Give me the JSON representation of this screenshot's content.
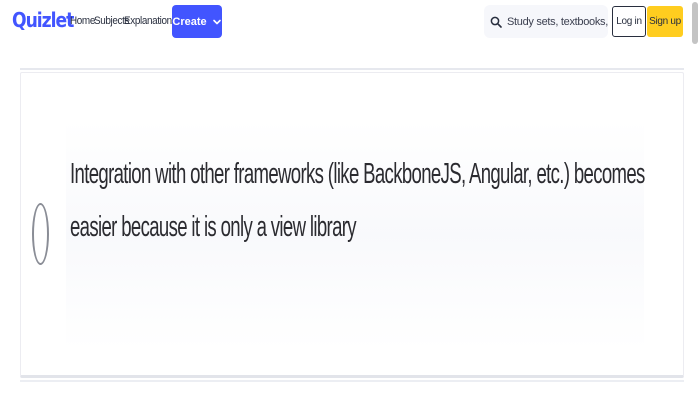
{
  "header": {
    "logo": "Quizlet",
    "nav": [
      "Home",
      "Subjects",
      "Explanations"
    ],
    "create_label": "Create",
    "search": {
      "placeholder": "Study sets, textbooks, ..."
    },
    "login_label": "Log in",
    "signup_label": "Sign up"
  },
  "question": {
    "option_text": "Integration with other frameworks (like BackboneJS, Angular, etc.) becomes easier because it is only a view library",
    "selected": false
  },
  "colors": {
    "brand": "#4255ff",
    "signup": "#ffcd1f",
    "text": "#282e3e"
  }
}
